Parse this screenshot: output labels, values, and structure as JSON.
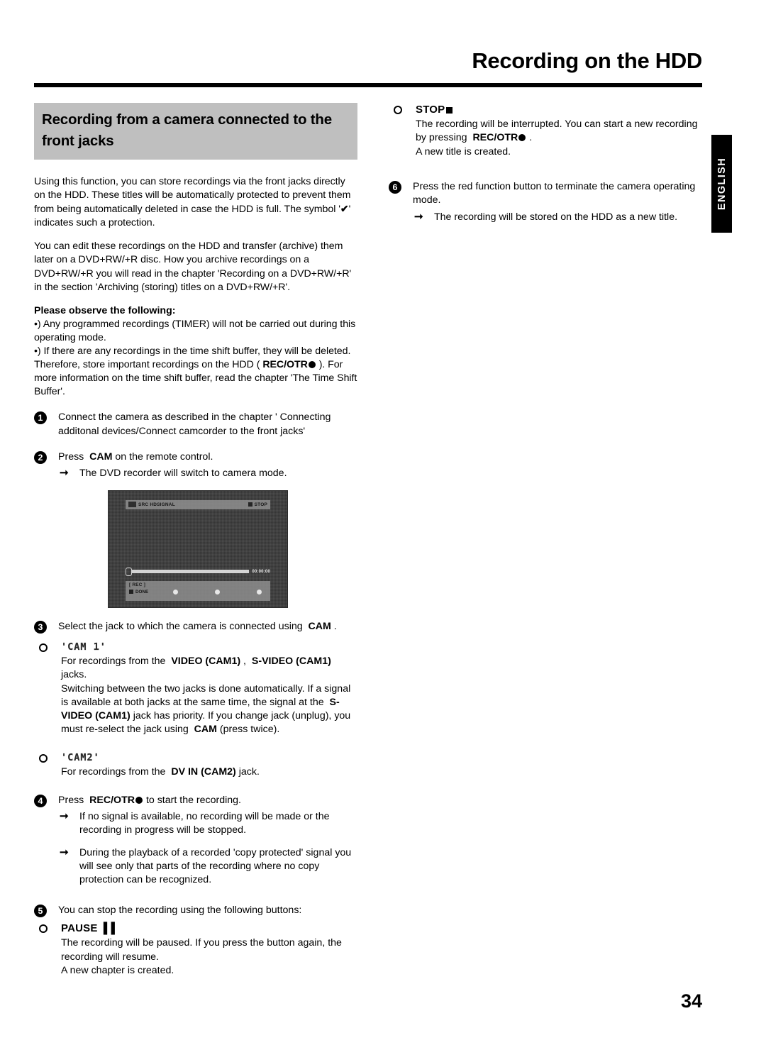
{
  "header": {
    "title": "Recording on the HDD"
  },
  "side_tab": {
    "label": "ENGLISH"
  },
  "page_number": "34",
  "left_column": {
    "section_heading": "Recording from a camera connected to the front jacks",
    "intro_paragraph_1_part1": "Using this function, you can store recordings via the front jacks directly on the HDD. These titles will be automatically protected to prevent them from being automatically deleted in case the HDD is full. The symbol '",
    "intro_paragraph_1_check": "✔",
    "intro_paragraph_1_part2": "' indicates such a protection.",
    "intro_paragraph_2": "You can edit these recordings on the HDD and transfer (archive) them later on a DVD+RW/+R disc. How you archive recordings on a DVD+RW/+R you will read in the chapter 'Recording on a DVD+RW/+R' in the section 'Archiving (storing) titles on a DVD+RW/+R'.",
    "observe_heading": "Please observe the following:",
    "observe_bullet_1": "•) Any programmed recordings (TIMER) will not be carried out during this operating mode.",
    "observe_bullet_2_part1": "•) If there are any recordings in the time shift buffer, they will be deleted. Therefore, store important recordings on the HDD ( ",
    "observe_bullet_2_bold": "REC/OTR",
    "observe_bullet_2_part2": " ). For more information on the time shift buffer, read the chapter 'The Time Shift Buffer'.",
    "steps": [
      {
        "number": "1",
        "text": "Connect the camera as described in the chapter ' Connecting additonal devices/Connect camcorder to the front jacks'"
      },
      {
        "number": "2",
        "text_part1": "Press  ",
        "text_bold": "CAM",
        "text_part2": " on the remote control.",
        "result": "The DVD recorder will switch to camera mode."
      },
      {
        "number": "3",
        "text_part1": "Select the jack to which the camera is connected using  ",
        "text_bold": "CAM",
        "text_part2": " ."
      },
      {
        "number": "4",
        "text_part1": "Press  ",
        "text_bold": "REC/OTR",
        "text_part2": " to start the recording.",
        "result_1": "If no signal is available, no recording will be made or the recording in progress will be stopped.",
        "result_2": "During the playback of a recorded 'copy protected' signal you will see only that parts of the recording where no copy protection can be recognized."
      },
      {
        "number": "5",
        "text": "You can stop the recording using the following buttons:"
      }
    ],
    "cam1_bullet": {
      "display_label": "'CAM 1'",
      "line1_part1": "For recordings from the  ",
      "line1_bold1": "VIDEO (CAM1)",
      "line1_part2": " ,  ",
      "line1_bold2": "S-VIDEO (CAM1)",
      "line1_part3": " jacks.",
      "line2_part1": "Switching between the two jacks is done automatically. If a signal is available at both jacks at the same time, the signal at the  ",
      "line2_bold1": "S-VIDEO (CAM1)",
      "line2_part2": " jack has priority. If you change jack (unplug), you must re-select the jack using  ",
      "line2_bold2": "CAM",
      "line2_part3": " (press twice)."
    },
    "cam2_bullet": {
      "display_label": "'CAM2'",
      "line1_part1": "For recordings from the  ",
      "line1_bold": "DV IN (CAM2)",
      "line1_part2": " jack."
    },
    "pause_bullet": {
      "label": "PAUSE",
      "glyph": "▐▐",
      "body": "The recording will be paused. If you press the button again, the recording will resume.\nA new chapter is created."
    },
    "device_screenshot": {
      "source_label": "SRC HDSIGNAL",
      "status_label": "STOP",
      "time_label": "00:00:00",
      "rec_label": "[ REC ]",
      "done_label": "DONE"
    }
  },
  "right_column": {
    "stop_bullet": {
      "label": "STOP",
      "body_part1": "The recording will be interrupted. You can start a new recording by pressing  ",
      "body_bold": "REC/OTR",
      "body_part2": " .",
      "body_line2": "A new title is created."
    },
    "step6": {
      "number": "6",
      "text": "Press the red function button to terminate the camera operating mode.",
      "result": "The recording will be stored on the HDD as a new title."
    }
  }
}
